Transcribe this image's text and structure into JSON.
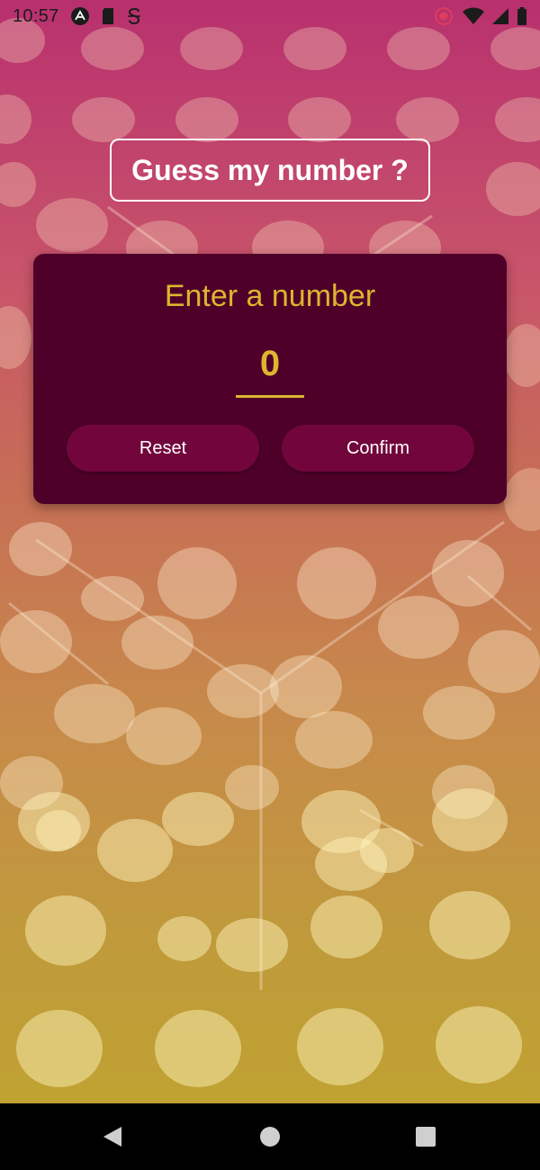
{
  "status_bar": {
    "time": "10:57",
    "icons": [
      "app-a-icon",
      "sd-card-icon",
      "sync-s-icon",
      "record-icon",
      "wifi-icon",
      "signal-icon",
      "battery-icon"
    ]
  },
  "title": "Guess my number ?",
  "card": {
    "heading": "Enter a number",
    "input_value": "0",
    "reset_label": "Reset",
    "confirm_label": "Confirm"
  },
  "nav_bar": {
    "icons": [
      "back-icon",
      "home-icon",
      "recents-icon"
    ]
  },
  "colors": {
    "gradient_top": "#b8306e",
    "gradient_bottom": "#c0a232",
    "card_bg": "#4e0029",
    "accent": "#ddb52f",
    "button_bg": "#72063c",
    "text_white": "#ffffff"
  }
}
